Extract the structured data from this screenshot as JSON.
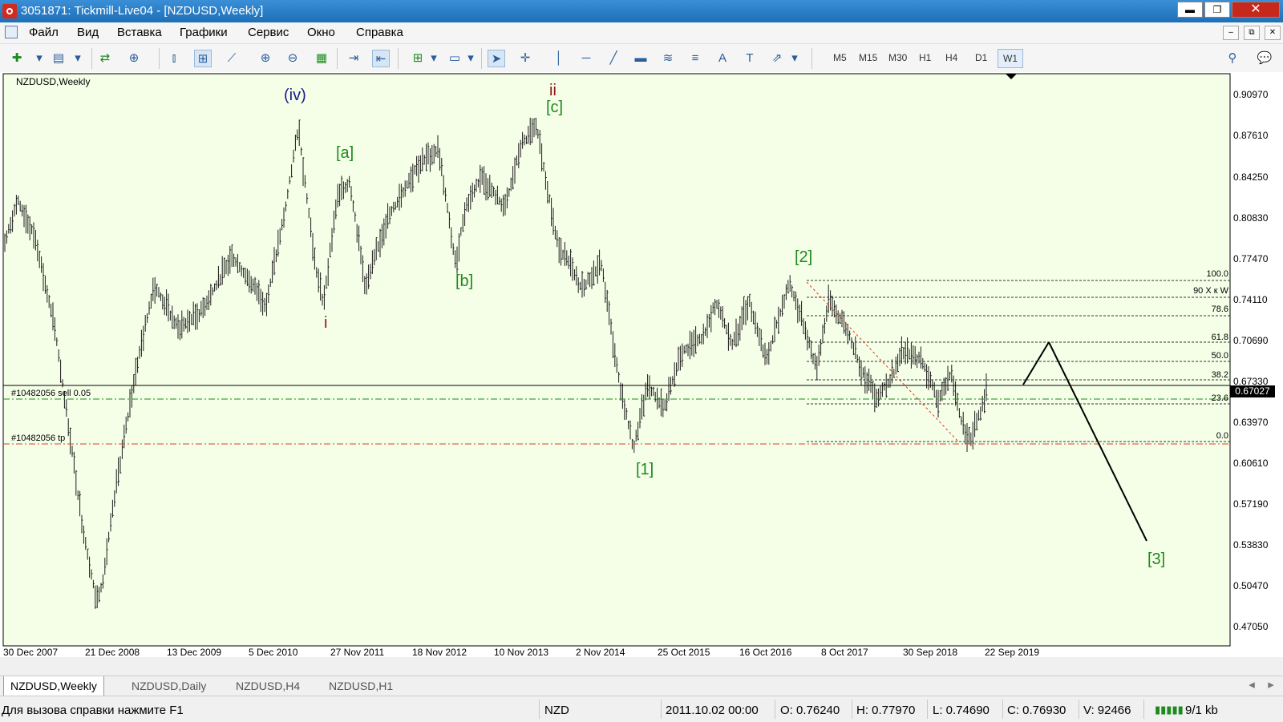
{
  "window": {
    "title": "3051871: Tickmill-Live04 - [NZDUSD,Weekly]",
    "minimize_label": "▬",
    "maximize_label": "❐",
    "close_label": "✕"
  },
  "menu": [
    "Файл",
    "Вид",
    "Вставка",
    "Графики",
    "Сервис",
    "Окно",
    "Справка"
  ],
  "mdi_controls": [
    "–",
    "⧉",
    "✕"
  ],
  "toolbar": {
    "timeframes": [
      "M5",
      "M15",
      "M30",
      "H1",
      "H4",
      "D1",
      "W1"
    ],
    "active_timeframe": "W1"
  },
  "chart": {
    "title": "NZDUSD,Weekly",
    "current_price": "0.67027",
    "bg_color": "#f5ffe8",
    "price_axis": [
      "0.90970",
      "0.87610",
      "0.84250",
      "0.80830",
      "0.77470",
      "0.74110",
      "0.70690",
      "0.67330",
      "0.63970",
      "0.60610",
      "0.57190",
      "0.53830",
      "0.50470",
      "0.47050"
    ],
    "date_axis": [
      "30 Dec 2007",
      "21 Dec 2008",
      "13 Dec 2009",
      "5 Dec 2010",
      "27 Nov 2011",
      "18 Nov 2012",
      "10 Nov 2013",
      "2 Nov 2014",
      "25 Oct 2015",
      "16 Oct 2016",
      "8 Oct 2017",
      "30 Sep 2018",
      "22 Sep 2019"
    ],
    "wave_labels": [
      {
        "text": "(iv)",
        "color": "#1a1a8c"
      },
      {
        "text": "[a]",
        "color": "#1c8a1c"
      },
      {
        "text": "i",
        "color": "#8b1a1a"
      },
      {
        "text": "[b]",
        "color": "#1c8a1c"
      },
      {
        "text": "ii",
        "color": "#8b1a1a"
      },
      {
        "text": "[c]",
        "color": "#1c8a1c"
      },
      {
        "text": "[1]",
        "color": "#1c8a1c"
      },
      {
        "text": "[2]",
        "color": "#1c8a1c"
      },
      {
        "text": "[3]",
        "color": "#1c8a1c"
      }
    ],
    "fib_levels": [
      "100.0",
      "90 X к W",
      "78.6",
      "61.8",
      "50.0",
      "38.2",
      "23.6",
      "0.0"
    ],
    "orders": {
      "sell_label": "#10482056 sell 0.05",
      "tp_label": "#10482056 tp"
    }
  },
  "tabs": [
    "NZDUSD,Weekly",
    "NZDUSD,Daily",
    "NZDUSD,H4",
    "NZDUSD,H1"
  ],
  "active_tab": "NZDUSD,Weekly",
  "status": {
    "help": "Для вызова справки нажмите F1",
    "symbol": "NZD",
    "datetime": "2011.10.02 00:00",
    "open": "O: 0.76240",
    "high": "H: 0.77970",
    "low": "L: 0.74690",
    "close": "C: 0.76930",
    "volume": "V: 92466",
    "traffic": "9/1 kb"
  }
}
